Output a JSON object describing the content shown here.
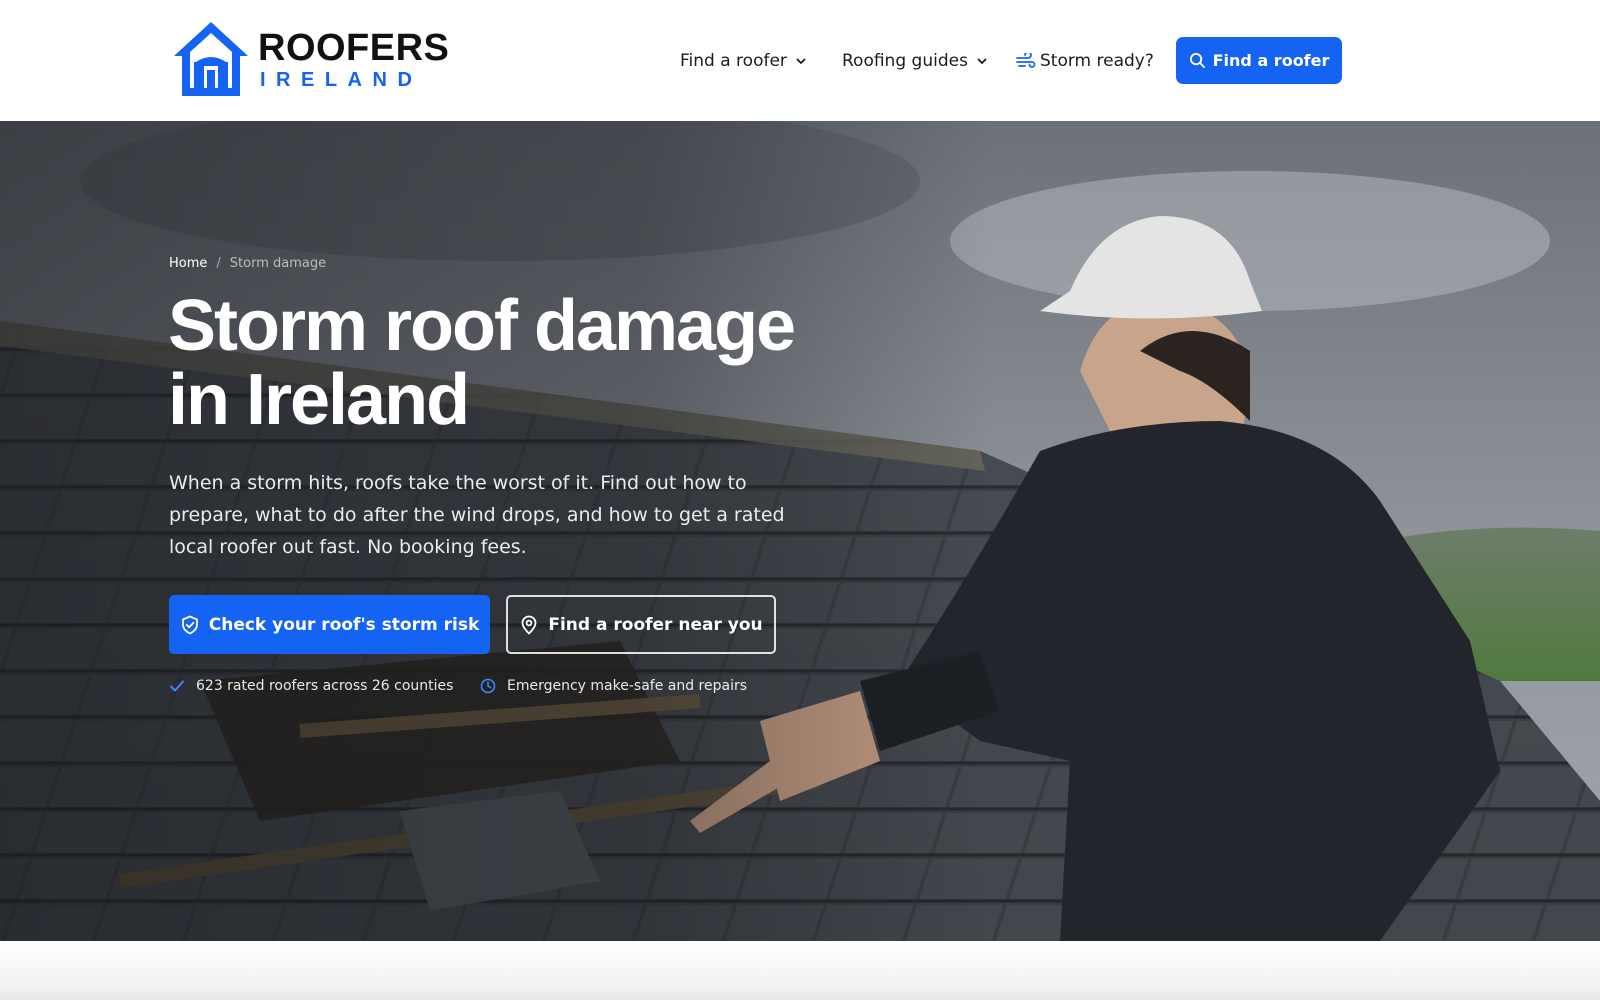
{
  "brand": {
    "name_top": "ROOFERS",
    "name_bottom": "IRELAND"
  },
  "nav": {
    "items": [
      {
        "label": "Find a roofer",
        "icon": "chevron-down-icon"
      },
      {
        "label": "Roofing guides",
        "icon": "chevron-down-icon"
      },
      {
        "label": "Storm ready?",
        "icon": "wind-icon"
      }
    ],
    "cta_label": "Find a roofer",
    "cta_icon": "search-icon"
  },
  "hero": {
    "breadcrumb": {
      "home": "Home",
      "separator": "/",
      "current": "Storm damage"
    },
    "title_line1": "Storm roof damage",
    "title_line2": "in Ireland",
    "subtitle": "When a storm hits, roofs take the worst of it. Find out how to prepare, what to do after the wind drops, and how to get a rated local roofer out fast. No booking fees.",
    "primary_button": {
      "label": "Check your roof's storm risk",
      "icon": "shield-check-icon"
    },
    "secondary_button": {
      "label": "Find a roofer near you",
      "icon": "map-pin-icon"
    },
    "badges": [
      {
        "text": "623 rated roofers across 26 counties",
        "icon": "check-icon"
      },
      {
        "text": "Emergency make-safe and repairs",
        "icon": "clock-icon"
      }
    ]
  },
  "colors": {
    "accent": "#1463f3",
    "text_dark": "#1c1c1c",
    "white": "#ffffff"
  }
}
